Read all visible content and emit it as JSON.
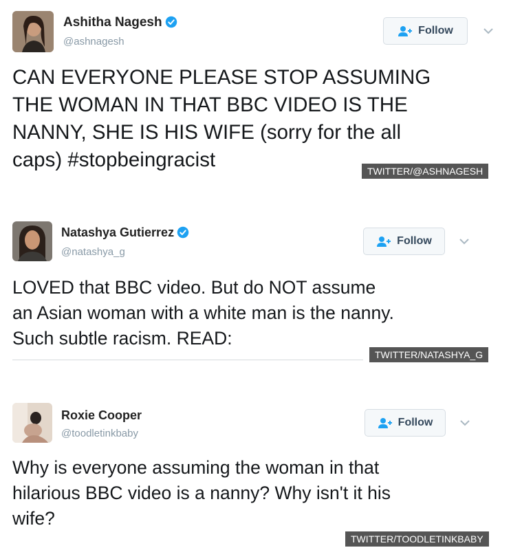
{
  "tweets": [
    {
      "name": "Ashitha Nagesh",
      "handle": "@ashnagesh",
      "verified": true,
      "follow_label": "Follow",
      "text": "CAN EVERYONE PLEASE STOP ASSUMING\nTHE WOMAN IN THAT BBC VIDEO IS THE\nNANNY, SHE IS HIS WIFE (sorry for the all\ncaps) #stopbeingracist",
      "credit": "TWITTER/@ASHNAGESH"
    },
    {
      "name": "Natashya Gutierrez",
      "handle": "@natashya_g",
      "verified": true,
      "follow_label": "Follow",
      "text": "LOVED that BBC video. But do NOT assume\nan Asian woman with a white man is the nanny.\nSuch subtle racism. READ:",
      "credit": "TWITTER/NATASHYA_G"
    },
    {
      "name": "Roxie Cooper",
      "handle": "@toodletinkbaby",
      "verified": false,
      "follow_label": "Follow",
      "text": "Why is everyone assuming the woman in that\nhilarious BBC video is a nanny? Why isn't it his\nwife?",
      "credit": "TWITTER/TOODLETINKBABY"
    }
  ],
  "colors": {
    "verified": "#1da1f2",
    "follow_text": "#34485c",
    "handle": "#8899a6",
    "credit_bg": "#555555"
  },
  "icons": {
    "verified": "verified-badge-icon",
    "follow": "add-person-icon",
    "menu": "chevron-down-icon"
  }
}
